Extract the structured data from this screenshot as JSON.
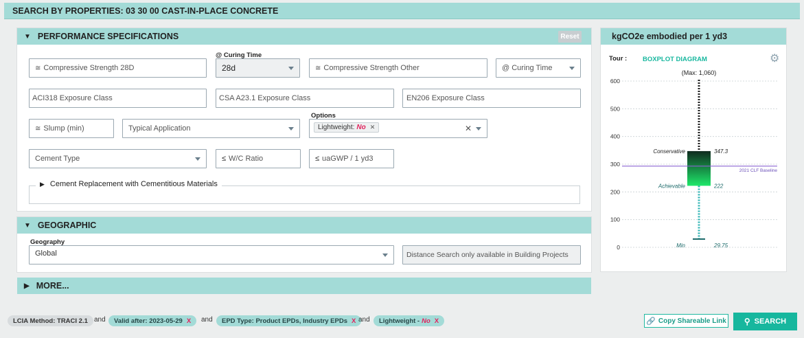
{
  "header": {
    "title": "SEARCH BY PROPERTIES: 03 30 00 CAST-IN-PLACE CONCRETE"
  },
  "performance": {
    "title": "PERFORMANCE SPECIFICATIONS",
    "reset": "Reset",
    "curing_time_label": "@ Curing Time",
    "compressive_28d": "Compressive Strength 28D",
    "curing_time_value": "28d",
    "compressive_other": "Compressive Strength Other",
    "curing_time_other": "@ Curing Time",
    "aci318": "ACI318 Exposure Class",
    "csa": "CSA A23.1 Exposure Class",
    "en206": "EN206 Exposure Class",
    "slump": "Slump (min)",
    "typical_application": "Typical Application",
    "options_label": "Options",
    "lightweight_chip_label": "Lightweight:",
    "lightweight_chip_value": "No",
    "cement_type": "Cement Type",
    "wc_ratio": "W/C Ratio",
    "ua_gwp": "uaGWP / 1 yd3",
    "cement_replacement": "Cement Replacement with Cementitious Materials"
  },
  "geographic": {
    "title": "GEOGRAPHIC",
    "geography_label": "Geography",
    "geography_value": "Global",
    "distance_note": "Distance Search only available in Building Projects"
  },
  "more": {
    "title": "MORE..."
  },
  "boxplot": {
    "title": "kgCO2e embodied per 1 yd3",
    "tour_label": "Tour :",
    "diagram_label": "BOXPLOT DIAGRAM",
    "max_label": "(Max: 1,060)",
    "conservative_label": "Conservative",
    "conservative_value": "347.3",
    "achievable_label": "Achievable",
    "achievable_value": "222",
    "min_label": "Min",
    "min_value": "29.75",
    "baseline_label": "2021 CLF Baseline"
  },
  "chart_data": {
    "type": "boxplot",
    "title": "kgCO2e embodied per 1 yd3",
    "y_ticks": [
      "600",
      "500",
      "400",
      "300",
      "200",
      "100",
      "0"
    ],
    "ylim": [
      0,
      600
    ],
    "max": 1060,
    "conservative": 347.3,
    "achievable": 222,
    "min": 29.75,
    "baseline": 293,
    "colors": {
      "box_top": "#0f2a1e",
      "box_bottom": "#1ee86a",
      "whisker": "#2db3b3",
      "baseline": "#8a63d2"
    }
  },
  "footer": {
    "filters": [
      {
        "label": "LCIA Method: TRACI 2.1"
      },
      {
        "label": "Valid after: 2023-05-29",
        "close": "X"
      },
      {
        "label": "EPD Type: Product EPDs, Industry EPDs",
        "close": "X"
      },
      {
        "label": "Lightweight -",
        "value": "No",
        "close": "X"
      }
    ],
    "and": "and",
    "copy_link": "Copy Shareable Link",
    "search": "SEARCH"
  }
}
